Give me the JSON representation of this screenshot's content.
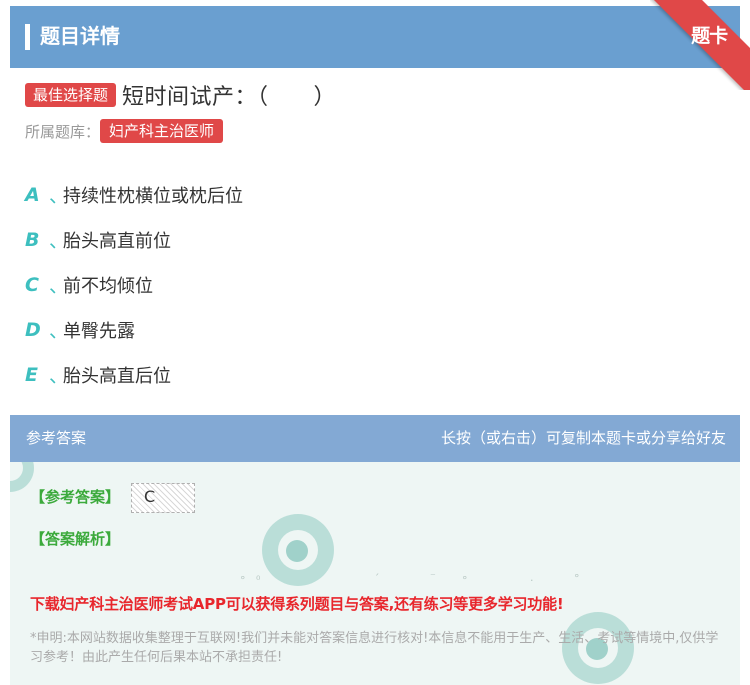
{
  "header": {
    "title": "题目详情"
  },
  "ribbon": {
    "label": "题卡"
  },
  "question": {
    "type_badge": "最佳选择题",
    "stem": "短时间试产：（　　）",
    "library_label": "所属题库：",
    "library_name": "妇产科主治医师"
  },
  "options": [
    {
      "letter": "A",
      "sep": "、",
      "text": "持续性枕横位或枕后位"
    },
    {
      "letter": "B",
      "sep": "、",
      "text": "胎头高直前位"
    },
    {
      "letter": "C",
      "sep": "、",
      "text": "前不均倾位"
    },
    {
      "letter": "D",
      "sep": "、",
      "text": "单臀先露"
    },
    {
      "letter": "E",
      "sep": "、",
      "text": "胎头高直后位"
    }
  ],
  "answer_section": {
    "title": "参考答案",
    "hint": "长按（或右击）可复制本题卡或分享给好友",
    "answer_label": "【参考答案】",
    "answer_value": "C",
    "analysis_label": "【答案解析】",
    "promo": "下载妇产科主治医师考试APP可以获得系列题目与答案,还有练习等更多学习功能!",
    "disclaimer": "*申明:本网站数据收集整理于互联网!我们并未能对答案信息进行核对!本信息不能用于生产、生活、考试等情境中,仅供学习参考！由此产生任何后果本站不承担责任!"
  },
  "colors": {
    "header_bg": "#6a9fd0",
    "ribbon_bg": "#e04848",
    "badge_bg": "#e04848",
    "option_letter": "#3dbfbf",
    "answer_label": "#3caa3c",
    "promo_text": "#e8262c"
  }
}
